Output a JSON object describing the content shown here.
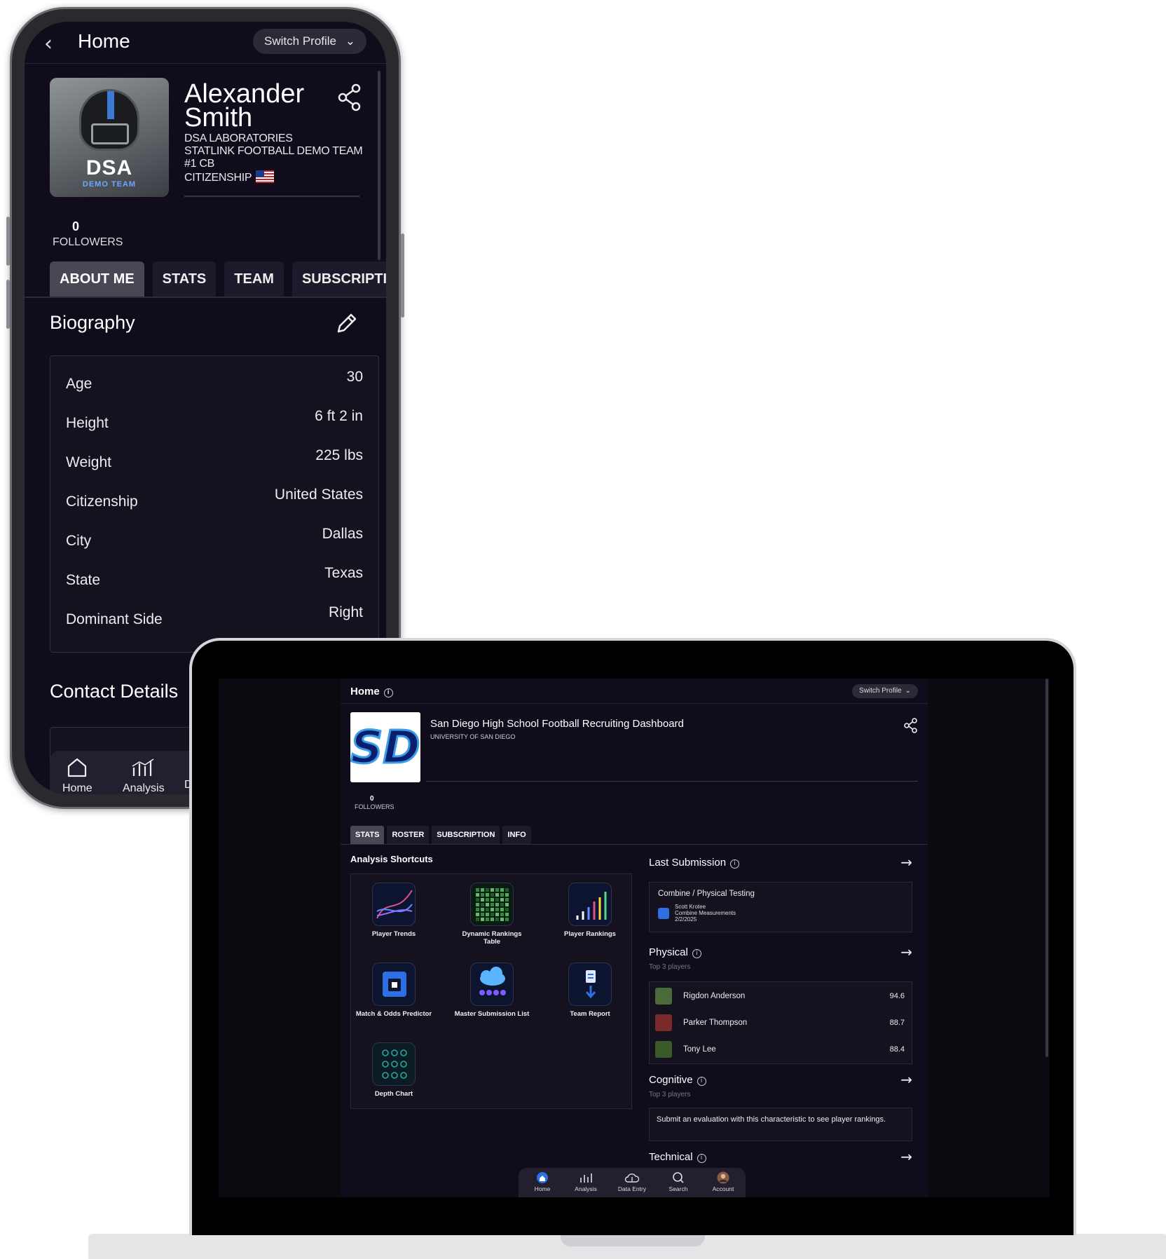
{
  "phone": {
    "header": {
      "back_icon": "chevron-left-icon",
      "title": "Home",
      "switch_profile": "Switch Profile"
    },
    "profile": {
      "avatar_logo": "DSA",
      "avatar_team": "DEMO TEAM",
      "name": "Alexander Smith",
      "org": "DSA LABORATORIES",
      "team": "STATLINK FOOTBALL DEMO TEAM",
      "position": "#1 CB",
      "citizenship_label": "CITIZENSHIP"
    },
    "followers": {
      "count": "0",
      "label": "FOLLOWERS"
    },
    "tabs": [
      "ABOUT ME",
      "STATS",
      "TEAM",
      "SUBSCRIPTION"
    ],
    "biography": {
      "title": "Biography",
      "rows": [
        {
          "key": "Age",
          "value": "30"
        },
        {
          "key": "Height",
          "value": "6 ft 2 in"
        },
        {
          "key": "Weight",
          "value": "225 lbs"
        },
        {
          "key": "Citizenship",
          "value": "United States"
        },
        {
          "key": "City",
          "value": "Dallas"
        },
        {
          "key": "State",
          "value": "Texas"
        },
        {
          "key": "Dominant Side",
          "value": "Right"
        }
      ]
    },
    "contact": {
      "title": "Contact Details"
    },
    "nav": {
      "home": "Home",
      "analysis": "Analysis",
      "data_entry": "Da"
    }
  },
  "laptop": {
    "header": {
      "title": "Home",
      "switch_profile": "Switch Profile"
    },
    "profile": {
      "logo_text": "SD",
      "name": "San Diego High School Football Recruiting Dashboard",
      "org": "UNIVERSITY OF SAN DIEGO"
    },
    "followers": {
      "count": "0",
      "label": "FOLLOWERS"
    },
    "tabs": [
      "STATS",
      "ROSTER",
      "SUBSCRIPTION",
      "INFO"
    ],
    "shortcuts": {
      "title": "Analysis Shortcuts",
      "items": [
        {
          "label": "Player Trends",
          "icon": "line-chart-icon"
        },
        {
          "label": "Dynamic Rankings Table",
          "icon": "grid-table-icon"
        },
        {
          "label": "Player Rankings",
          "icon": "bar-rankings-icon"
        },
        {
          "label": "Match & Odds Predictor",
          "icon": "predictor-icon"
        },
        {
          "label": "Master Submission List",
          "icon": "cloud-list-icon"
        },
        {
          "label": "Team Report",
          "icon": "report-icon"
        },
        {
          "label": "Depth Chart",
          "icon": "depth-chart-icon"
        }
      ]
    },
    "last_submission": {
      "title": "Last Submission",
      "category": "Combine / Physical Testing",
      "user": "Scott Krotee",
      "form": "Combine Measurements",
      "date": "2/2/2025"
    },
    "physical": {
      "title": "Physical",
      "subtitle": "Top 3 players",
      "players": [
        {
          "name": "Rigdon Anderson",
          "score": "94.6"
        },
        {
          "name": "Parker Thompson",
          "score": "88.7"
        },
        {
          "name": "Tony Lee",
          "score": "88.4"
        }
      ]
    },
    "cognitive": {
      "title": "Cognitive",
      "subtitle": "Top 3 players",
      "message": "Submit an evaluation with this characteristic to see player rankings."
    },
    "technical": {
      "title": "Technical"
    },
    "nav": {
      "home": "Home",
      "analysis": "Analysis",
      "data_entry": "Data Entry",
      "search": "Search",
      "account": "Account"
    },
    "colors": {
      "accent": "#2f6fe4",
      "background": "#100c1c"
    }
  }
}
